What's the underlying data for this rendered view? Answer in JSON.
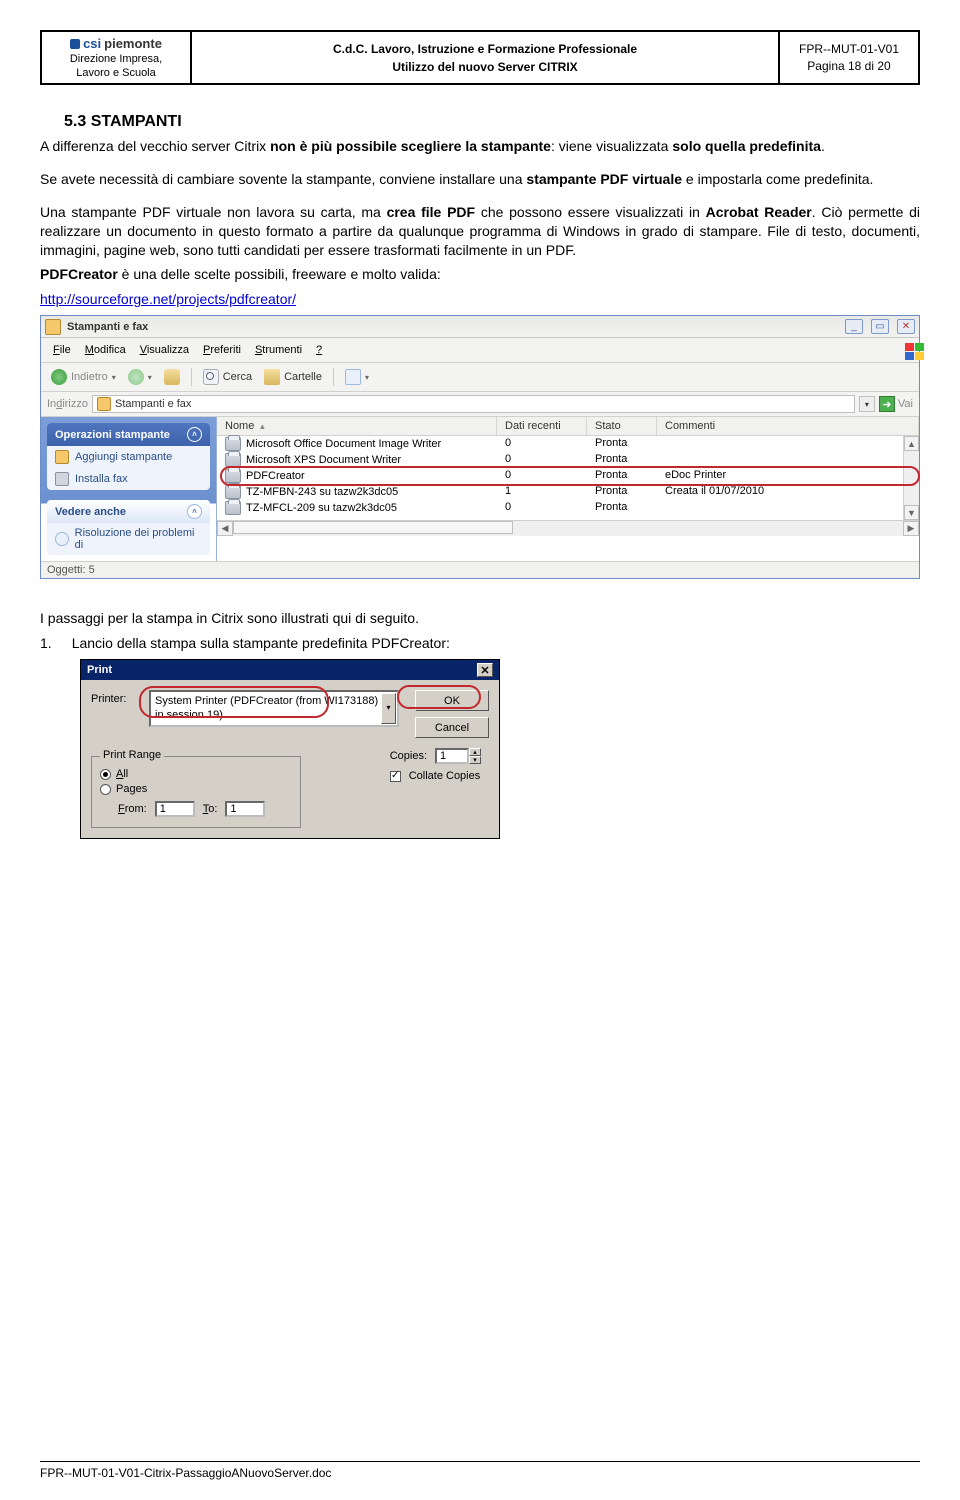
{
  "header": {
    "logo_brand1": "csi",
    "logo_brand2": "piemonte",
    "org_line1": "Direzione Impresa,",
    "org_line2": "Lavoro e Scuola",
    "title_line1": "C.d.C. Lavoro, Istruzione e Formazione Professionale",
    "title_line2": "Utilizzo del nuovo Server CITRIX",
    "doc_id": "FPR--MUT-01-V01",
    "page_info": "Pagina 18 di 20"
  },
  "doc": {
    "section_heading": "5.3  STAMPANTI",
    "p1a": "A differenza del vecchio server Citrix ",
    "p1b": "non è più possibile scegliere la stampante",
    "p1c": ": viene visualizzata ",
    "p1d": "solo quella predefinita",
    "p1e": ".",
    "p2a": "Se avete necessità di cambiare sovente la stampante, conviene installare una ",
    "p2b": "stampante PDF virtuale",
    "p2c": " e impostarla come predefinita.",
    "p3a": "Una stampante PDF virtuale non lavora su carta, ma ",
    "p3b": "crea file PDF",
    "p3c": " che possono essere visualizzati in ",
    "p3d": "Acrobat Reader",
    "p3e": ". Ciò permette di realizzare un documento in questo formato a partire da qualunque programma di Windows in grado di stampare. File di testo, documenti, immagini, pagine web, sono tutti candidati per essere trasformati facilmente in un PDF.",
    "p4a": "PDFCreator",
    "p4b": " è una delle scelte possibili, freeware e molto valida:",
    "link": "http://sourceforge.net/projects/pdfcreator/",
    "p5": "I passaggi per la stampa in Citrix sono illustrati qui di seguito.",
    "p6n": "1.",
    "p6": "Lancio della stampa sulla stampante predefinita PDFCreator:"
  },
  "xp": {
    "title": "Stampanti e fax",
    "menu": {
      "file": "File",
      "modifica": "Modifica",
      "visualizza": "Visualizza",
      "preferiti": "Preferiti",
      "strumenti": "Strumenti",
      "help": "?"
    },
    "toolbar": {
      "indietro": "Indietro",
      "cerca": "Cerca",
      "cartelle": "Cartelle"
    },
    "addr_label": "Indirizzo",
    "addr_value": "Stampanti e fax",
    "go": "Vai",
    "side": {
      "ops_title": "Operazioni stampante",
      "add": "Aggiungi stampante",
      "fax": "Installa fax",
      "also_title": "Vedere anche",
      "help": "Risoluzione dei problemi di"
    },
    "cols": {
      "nome": "Nome",
      "dati": "Dati recenti",
      "stato": "Stato",
      "commenti": "Commenti"
    },
    "rows": [
      {
        "name": "Microsoft Office Document Image Writer",
        "dati": "0",
        "stato": "Pronta",
        "comm": ""
      },
      {
        "name": "Microsoft XPS Document Writer",
        "dati": "0",
        "stato": "Pronta",
        "comm": ""
      },
      {
        "name": "PDFCreator",
        "dati": "0",
        "stato": "Pronta",
        "comm": "eDoc Printer"
      },
      {
        "name": "TZ-MFBN-243 su tazw2k3dc05",
        "dati": "1",
        "stato": "Pronta",
        "comm": "Creata il 01/07/2010"
      },
      {
        "name": "TZ-MFCL-209 su tazw2k3dc05",
        "dati": "0",
        "stato": "Pronta",
        "comm": ""
      }
    ],
    "status": "Oggetti: 5"
  },
  "print": {
    "title": "Print",
    "printer_lbl": "Printer:",
    "printer_val": "System Printer (PDFCreator (from WI173188) in session 19)",
    "ok": "OK",
    "cancel": "Cancel",
    "range_legend": "Print Range",
    "all": "All",
    "pages": "Pages",
    "from": "From:",
    "from_v": "1",
    "to": "To:",
    "to_v": "1",
    "copies": "Copies:",
    "copies_v": "1",
    "collate": "Collate Copies"
  },
  "footer": "FPR--MUT-01-V01-Citrix-PassaggioANuovoServer.doc"
}
